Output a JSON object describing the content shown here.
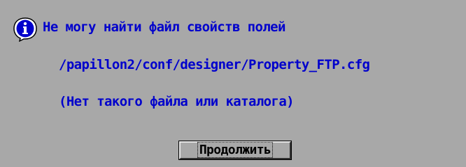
{
  "dialog": {
    "icon": "info-icon",
    "message_line_1": "Не могу найти файл свойств полей",
    "message_line_2": "/papillon2/conf/designer/Property_FTP.cfg",
    "message_line_3": "(Нет такого файла или каталога)",
    "continue_label": "Продолжить",
    "colors": {
      "background": "#a8a8a8",
      "message_text": "#0000cc",
      "icon_fill": "#0000cc"
    }
  }
}
